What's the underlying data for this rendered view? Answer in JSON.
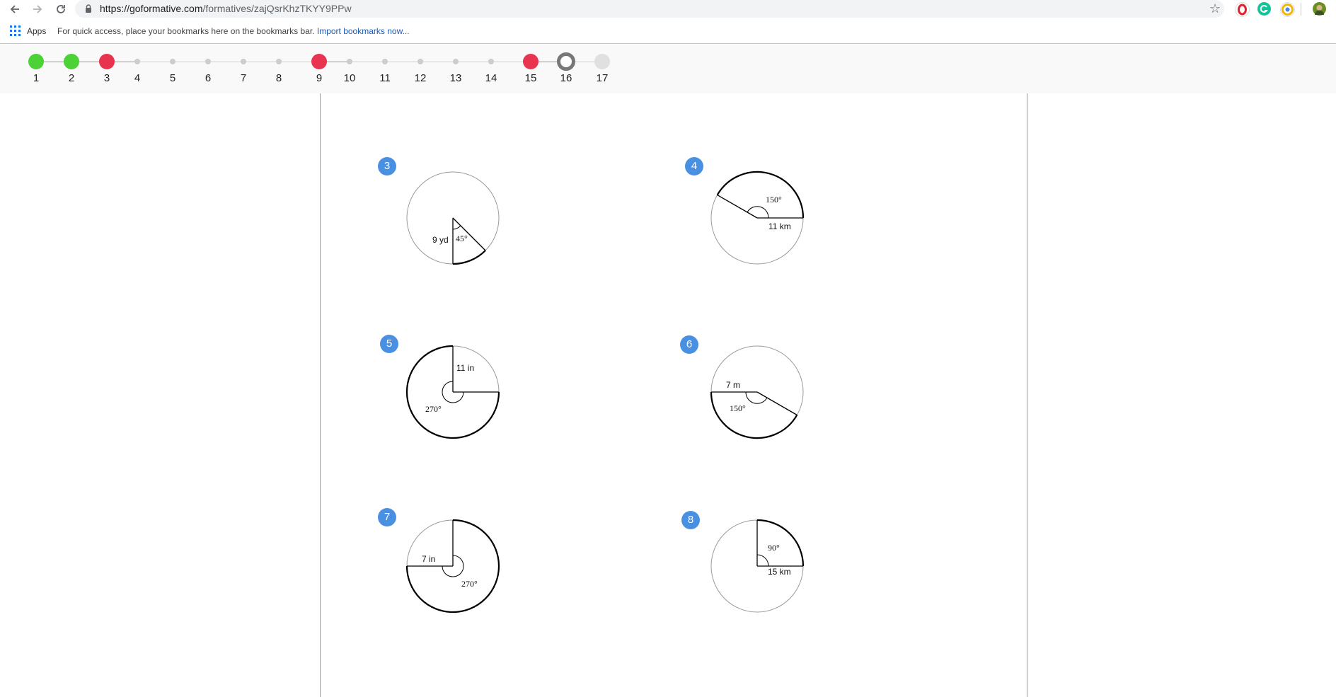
{
  "browser": {
    "url_host": "https://goformative.com",
    "url_path": "/formatives/zajQsrKhzTKYY9PPw"
  },
  "bookmarks_bar": {
    "apps_label": "Apps",
    "hint_text": "For quick access, place your bookmarks here on the bookmarks bar.",
    "import_link": "Import bookmarks now..."
  },
  "questions": [
    {
      "number": "1",
      "status": "correct"
    },
    {
      "number": "2",
      "status": "correct"
    },
    {
      "number": "3",
      "status": "incorrect"
    },
    {
      "number": "4",
      "status": "unanswered"
    },
    {
      "number": "5",
      "status": "unanswered"
    },
    {
      "number": "6",
      "status": "unanswered"
    },
    {
      "number": "7",
      "status": "unanswered"
    },
    {
      "number": "8",
      "status": "unanswered"
    },
    {
      "number": "9",
      "status": "incorrect"
    },
    {
      "number": "10",
      "status": "unanswered"
    },
    {
      "number": "11",
      "status": "unanswered"
    },
    {
      "number": "12",
      "status": "unanswered"
    },
    {
      "number": "13",
      "status": "unanswered"
    },
    {
      "number": "14",
      "status": "unanswered"
    },
    {
      "number": "15",
      "status": "incorrect"
    },
    {
      "number": "16",
      "status": "current"
    },
    {
      "number": "17",
      "status": "upcoming"
    }
  ],
  "status_colors": {
    "correct": "#4cd137",
    "incorrect": "#e8344e",
    "current": "#777777",
    "upcoming": "#e0e0e0",
    "unanswered": "#cccccc",
    "badge": "#4a90e2"
  },
  "problems": [
    {
      "badge": "3",
      "radius_label": "9 yd",
      "angle_label": "45°"
    },
    {
      "badge": "4",
      "radius_label": "11 km",
      "angle_label": "150°"
    },
    {
      "badge": "5",
      "radius_label": "11 in",
      "angle_label": "270°"
    },
    {
      "badge": "6",
      "radius_label": "7 m",
      "angle_label": "150°"
    },
    {
      "badge": "7",
      "radius_label": "7 in",
      "angle_label": "270°"
    },
    {
      "badge": "8",
      "radius_label": "15 km",
      "angle_label": "90°"
    }
  ]
}
